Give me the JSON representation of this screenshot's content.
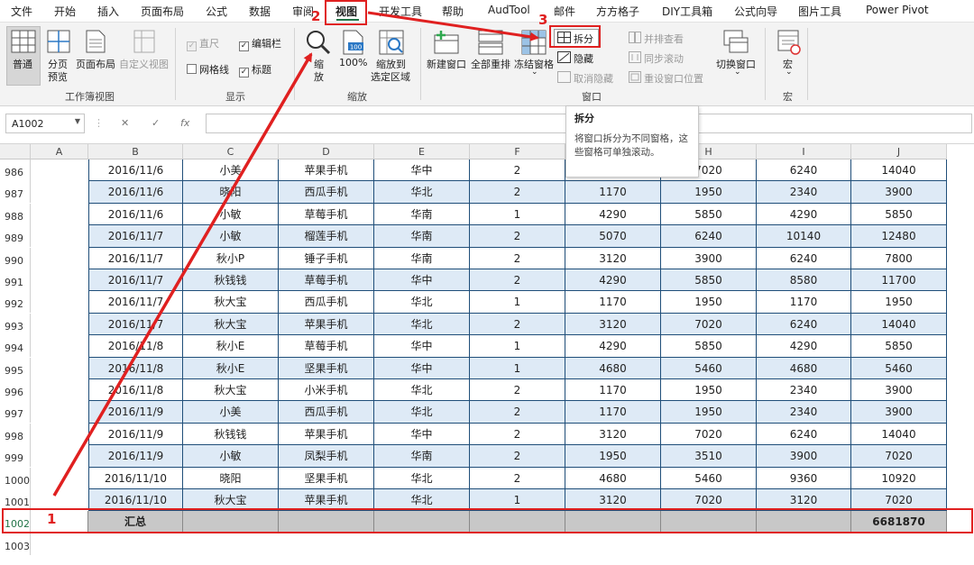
{
  "menu": [
    "文件",
    "开始",
    "插入",
    "页面布局",
    "公式",
    "数据",
    "审阅",
    "视图",
    "开发工具",
    "帮助",
    "AudTool",
    "邮件",
    "方方格子",
    "DIY工具箱",
    "公式向导",
    "图片工具",
    "Power Pivot"
  ],
  "ribbon": {
    "workbook_views": {
      "label": "工作簿视图",
      "normal": "普通",
      "page_break_line1": "分页",
      "page_break_line2": "预览",
      "page_layout": "页面布局",
      "custom_view": "自定义视图"
    },
    "show": {
      "label": "显示",
      "ruler": "直尺",
      "edit_bar": "编辑栏",
      "gridlines": "网格线",
      "headings": "标题"
    },
    "zoom": {
      "label": "缩放",
      "zoom_line1": "缩",
      "zoom_line2": "放",
      "hundred": "100%",
      "hundred_icon_text": "100",
      "zoom_sel_line1": "缩放到",
      "zoom_sel_line2": "选定区域"
    },
    "window": {
      "label": "窗口",
      "new_window": "新建窗口",
      "arrange_all": "全部重排",
      "freeze_panes": "冻结窗格",
      "split": "拆分",
      "hide": "隐藏",
      "unhide": "取消隐藏",
      "side_by_side": "并排查看",
      "sync_scroll": "同步滚动",
      "reset_pos": "重设窗口位置",
      "switch_line1": "切换窗口"
    },
    "macro": {
      "label": "宏",
      "macros": "宏"
    }
  },
  "formula_bar": {
    "name_box": "A1002",
    "fx": "fx",
    "cancel": "✕",
    "enter": "✓"
  },
  "tooltip": {
    "title": "拆分",
    "body": "将窗口拆分为不同窗格，这些窗格可单独滚动。"
  },
  "columns": [
    "A",
    "B",
    "C",
    "D",
    "E",
    "F",
    "G",
    "H",
    "I",
    "J"
  ],
  "rows": [
    {
      "n": "986",
      "v": [
        "2016/11/6",
        "小美",
        "苹果手机",
        "华中",
        "2",
        "",
        "7020",
        "6240",
        "14040"
      ]
    },
    {
      "n": "987",
      "v": [
        "2016/11/6",
        "晓阳",
        "西瓜手机",
        "华北",
        "2",
        "1170",
        "1950",
        "2340",
        "3900"
      ]
    },
    {
      "n": "988",
      "v": [
        "2016/11/6",
        "小敏",
        "草莓手机",
        "华南",
        "1",
        "4290",
        "5850",
        "4290",
        "5850"
      ]
    },
    {
      "n": "989",
      "v": [
        "2016/11/7",
        "小敏",
        "榴莲手机",
        "华南",
        "2",
        "5070",
        "6240",
        "10140",
        "12480"
      ]
    },
    {
      "n": "990",
      "v": [
        "2016/11/7",
        "秋小P",
        "锤子手机",
        "华南",
        "2",
        "3120",
        "3900",
        "6240",
        "7800"
      ]
    },
    {
      "n": "991",
      "v": [
        "2016/11/7",
        "秋钱钱",
        "草莓手机",
        "华中",
        "2",
        "4290",
        "5850",
        "8580",
        "11700"
      ]
    },
    {
      "n": "992",
      "v": [
        "2016/11/7",
        "秋大宝",
        "西瓜手机",
        "华北",
        "1",
        "1170",
        "1950",
        "1170",
        "1950"
      ]
    },
    {
      "n": "993",
      "v": [
        "2016/11/7",
        "秋大宝",
        "苹果手机",
        "华北",
        "2",
        "3120",
        "7020",
        "6240",
        "14040"
      ]
    },
    {
      "n": "994",
      "v": [
        "2016/11/8",
        "秋小E",
        "草莓手机",
        "华中",
        "1",
        "4290",
        "5850",
        "4290",
        "5850"
      ]
    },
    {
      "n": "995",
      "v": [
        "2016/11/8",
        "秋小E",
        "坚果手机",
        "华中",
        "1",
        "4680",
        "5460",
        "4680",
        "5460"
      ]
    },
    {
      "n": "996",
      "v": [
        "2016/11/8",
        "秋大宝",
        "小米手机",
        "华北",
        "2",
        "1170",
        "1950",
        "2340",
        "3900"
      ]
    },
    {
      "n": "997",
      "v": [
        "2016/11/9",
        "小美",
        "西瓜手机",
        "华北",
        "2",
        "1170",
        "1950",
        "2340",
        "3900"
      ]
    },
    {
      "n": "998",
      "v": [
        "2016/11/9",
        "秋钱钱",
        "苹果手机",
        "华中",
        "2",
        "3120",
        "7020",
        "6240",
        "14040"
      ]
    },
    {
      "n": "999",
      "v": [
        "2016/11/9",
        "小敏",
        "凤梨手机",
        "华南",
        "2",
        "1950",
        "3510",
        "3900",
        "7020"
      ]
    },
    {
      "n": "1000",
      "v": [
        "2016/11/10",
        "晓阳",
        "坚果手机",
        "华北",
        "2",
        "4680",
        "5460",
        "9360",
        "10920"
      ]
    },
    {
      "n": "1001",
      "v": [
        "2016/11/10",
        "秋大宝",
        "苹果手机",
        "华北",
        "1",
        "3120",
        "7020",
        "3120",
        "7020"
      ]
    }
  ],
  "total_row": {
    "n": "1002",
    "label": "汇总",
    "total": "6681870"
  },
  "empty_row": "1003",
  "annotations": {
    "step1": "1",
    "step2": "2",
    "step3": "3"
  },
  "colors": {
    "accent_red": "#e02020",
    "excel_green": "#217346",
    "row_alt": "#deeaf6",
    "table_border": "#1f4e79"
  }
}
